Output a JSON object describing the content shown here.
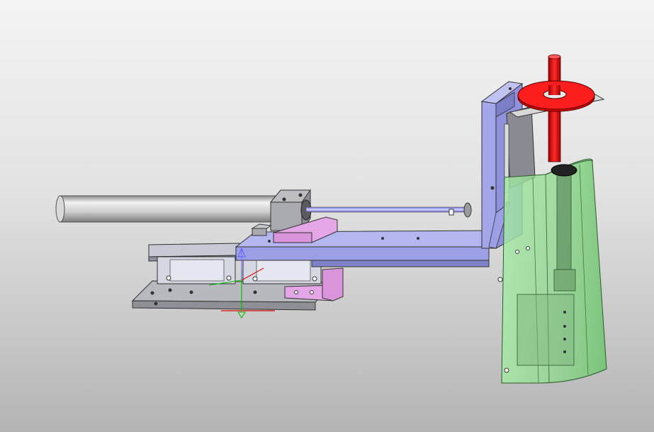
{
  "viewport": {
    "background_top": "#f4f4f4",
    "background_bottom": "#b4b4b4"
  },
  "model": {
    "part_colors": {
      "plate": "#a9a9b2",
      "rail_block": "#c9ccd6",
      "bracket": "#9d9fe6",
      "pink_block": "#e4a6e6",
      "rod": "#c7c7c7",
      "shaft": "#8f8fef",
      "red_shaft": "#e00000",
      "cover": "#8fe08f"
    },
    "triad_colors": {
      "x_axis": "#e00000",
      "y_axis": "#00c000",
      "z_axis": "#6060ff"
    }
  }
}
